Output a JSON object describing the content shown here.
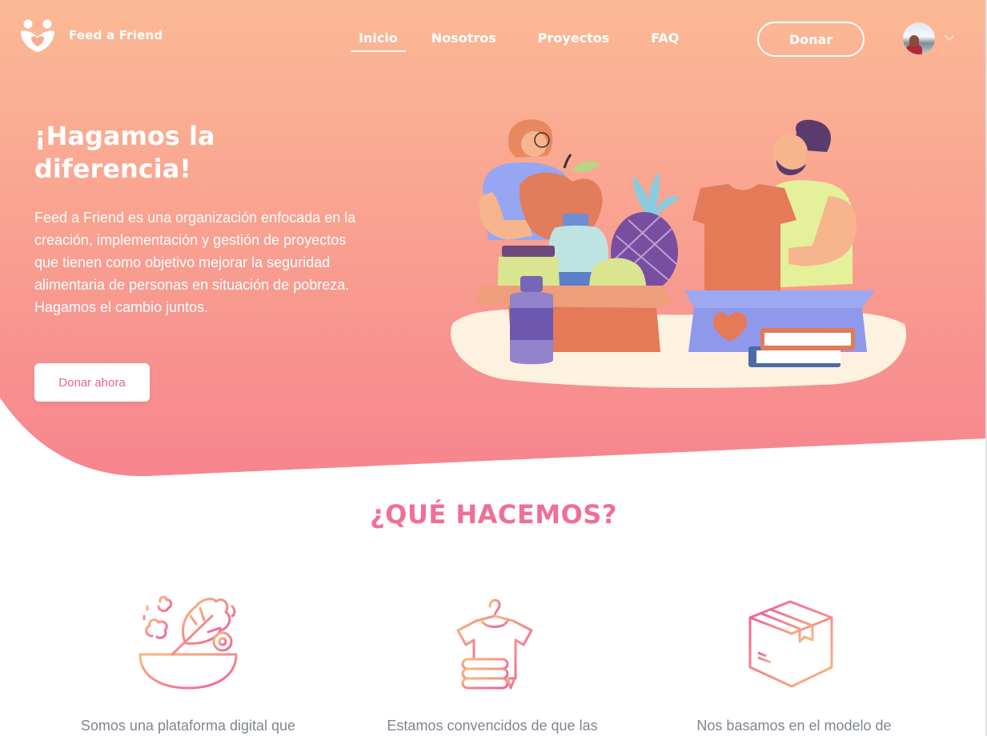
{
  "brand": {
    "name": "Feed a Friend"
  },
  "nav": {
    "links": [
      {
        "label": "Inicio",
        "active": true
      },
      {
        "label": "Nosotros",
        "active": false
      },
      {
        "label": "Proyectos",
        "active": false
      },
      {
        "label": "FAQ",
        "active": false
      }
    ],
    "donate_label": "Donar"
  },
  "user_menu": {
    "avatar_icon": "user-avatar",
    "caret_icon": "chevron-down-icon"
  },
  "hero": {
    "title": "¡Hagamos la diferencia!",
    "description": "Feed a Friend es una organización enfocada en la creación, implementación y gestión de proyectos que tienen como objetivo mejorar la seguridad alimentaria de personas en situación de pobreza. Hagamos el cambio juntos.",
    "cta_label": "Donar ahora"
  },
  "section": {
    "title": "¿QUÉ HACEMOS?",
    "features": [
      {
        "icon": "salad-bowl-icon",
        "text": "Somos una plataforma digital que"
      },
      {
        "icon": "clothes-icon",
        "text": "Estamos convencidos de que las"
      },
      {
        "icon": "box-icon",
        "text": "Nos basamos en el modelo de"
      }
    ]
  },
  "colors": {
    "hero_top": "#fbb995",
    "hero_bottom": "#f7848f",
    "accent": "#ef6f95",
    "text_gray": "#7f8591"
  }
}
